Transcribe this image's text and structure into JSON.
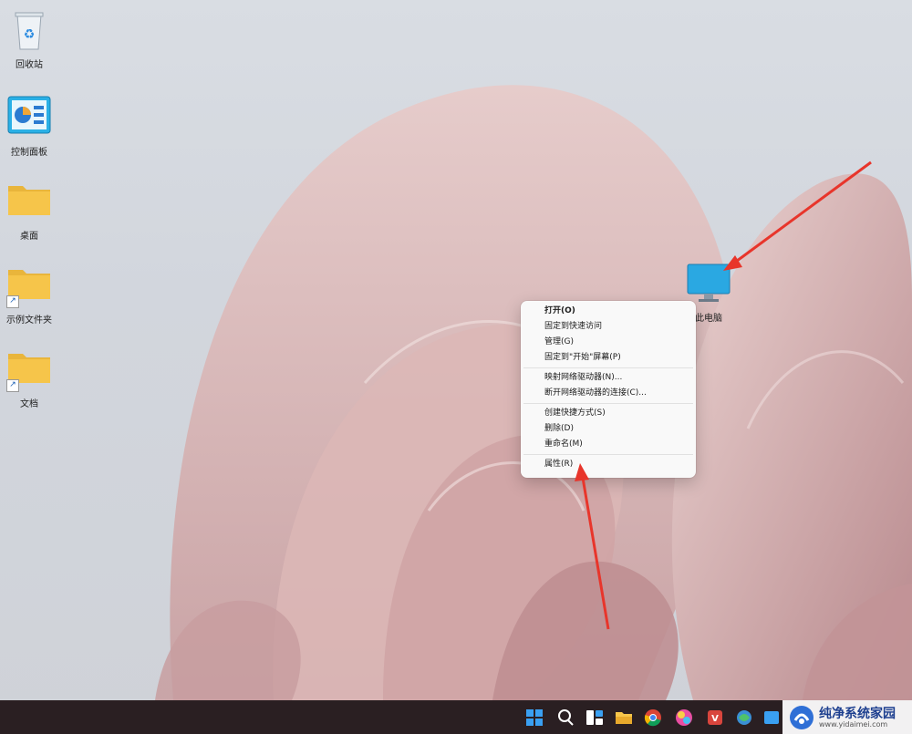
{
  "desktop": {
    "icons": [
      {
        "label": "回收站"
      },
      {
        "label": "控制面板"
      },
      {
        "label": "桌面"
      },
      {
        "label": "示例文件夹"
      },
      {
        "label": "文档"
      },
      {
        "label": "此电脑"
      }
    ]
  },
  "context_menu": {
    "groups": [
      [
        {
          "label": "打开(O)"
        },
        {
          "label": "固定到快速访问"
        },
        {
          "label": "管理(G)"
        },
        {
          "label": "固定到\"开始\"屏幕(P)"
        }
      ],
      [
        {
          "label": "映射网络驱动器(N)..."
        },
        {
          "label": "断开网络驱动器的连接(C)..."
        }
      ],
      [
        {
          "label": "创建快捷方式(S)"
        },
        {
          "label": "删除(D)"
        },
        {
          "label": "重命名(M)"
        }
      ],
      [
        {
          "label": "属性(R)"
        }
      ]
    ]
  },
  "taskbar": {
    "icons": [
      "start-icon",
      "search-icon",
      "widgets-icon",
      "file-explorer-icon",
      "chrome-icon",
      "color-app-icon",
      "video-app-icon",
      "network-icon",
      "app-icon"
    ]
  },
  "watermark": {
    "title": "纯净系统家园",
    "url": "www.yidaimei.com"
  },
  "colors": {
    "accent_red": "#e8352b",
    "taskbar": "#2a1f22",
    "folder": "#f6c54a"
  }
}
